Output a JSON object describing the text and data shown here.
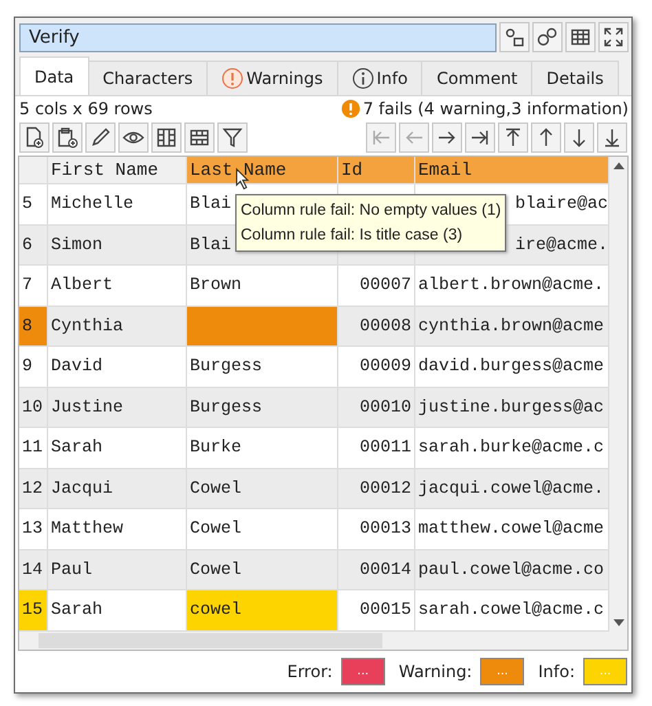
{
  "window": {
    "title": "Verify",
    "title_buttons": [
      {
        "kind": "settings-small"
      },
      {
        "kind": "gears"
      },
      {
        "kind": "table"
      },
      {
        "kind": "expand"
      }
    ]
  },
  "tabs": [
    {
      "label": "Data",
      "selected": true
    },
    {
      "label": "Characters",
      "selected": false
    },
    {
      "label": "Warnings",
      "selected": false,
      "kind": "warning"
    },
    {
      "label": "Info",
      "selected": false,
      "kind": "info"
    },
    {
      "label": "Comment",
      "selected": false
    },
    {
      "label": "Details",
      "selected": false
    }
  ],
  "summary": "5 cols x 69 rows",
  "fails": "7 fails (4 warning,3 information)",
  "toolbar": [
    {
      "kind": "new-file"
    },
    {
      "kind": "paste"
    },
    {
      "kind": "pencil"
    },
    {
      "kind": "eye"
    },
    {
      "kind": "columns"
    },
    {
      "kind": "rows"
    },
    {
      "kind": "filter"
    }
  ],
  "navigation": [
    {
      "kind": "first",
      "disabled": true
    },
    {
      "kind": "left",
      "disabled": true
    },
    {
      "kind": "right",
      "disabled": false
    },
    {
      "kind": "last",
      "disabled": false
    },
    {
      "kind": "top",
      "disabled": false
    },
    {
      "kind": "up",
      "disabled": false
    },
    {
      "kind": "down",
      "disabled": false
    },
    {
      "kind": "bottom",
      "disabled": false
    }
  ],
  "table": {
    "columns": [
      {
        "label": "First Name",
        "highlighted": false
      },
      {
        "label": "Last Name",
        "highlighted": true
      },
      {
        "label": "Id",
        "highlighted": true
      },
      {
        "label": "Email",
        "highlighted": true
      }
    ],
    "rows": [
      {
        "num": "5",
        "first": "Michelle",
        "last": "Blai",
        "email": "blaire@ac",
        "warning": false,
        "info": false,
        "covered": true
      },
      {
        "num": "6",
        "first": "Simon",
        "last": "Blai",
        "email": "ire@acme.",
        "warning": false,
        "info": false,
        "covered": true
      },
      {
        "num": "7",
        "first": "Albert",
        "last": "Brown",
        "id": "00007",
        "email": "albert.brown@acme.",
        "warning": false,
        "info": false,
        "covered": false
      },
      {
        "num": "8",
        "first": "Cynthia",
        "id": "00008",
        "email": "cynthia.brown@acme",
        "warning": true,
        "info": false,
        "covered": false
      },
      {
        "num": "9",
        "first": "David",
        "last": "Burgess",
        "id": "00009",
        "email": "david.burgess@acme",
        "warning": false,
        "info": false,
        "covered": false
      },
      {
        "num": "10",
        "first": "Justine",
        "last": "Burgess",
        "id": "00010",
        "email": "justine.burgess@ac",
        "warning": false,
        "info": false,
        "covered": false
      },
      {
        "num": "11",
        "first": "Sarah",
        "last": "Burke",
        "id": "00011",
        "email": "sarah.burke@acme.c",
        "warning": false,
        "info": false,
        "covered": false
      },
      {
        "num": "12",
        "first": "Jacqui",
        "last": "Cowel",
        "id": "00012",
        "email": "jacqui.cowel@acme.",
        "warning": false,
        "info": false,
        "covered": false
      },
      {
        "num": "13",
        "first": "Matthew",
        "last": "Cowel",
        "id": "00013",
        "email": "matthew.cowel@acme",
        "warning": false,
        "info": false,
        "covered": false
      },
      {
        "num": "14",
        "first": "Paul",
        "last": "Cowel",
        "id": "00014",
        "email": "paul.cowel@acme.co",
        "warning": false,
        "info": false,
        "covered": false
      },
      {
        "num": "15",
        "first": "Sarah",
        "last": "cowel",
        "id": "00015",
        "email": "sarah.cowel@acme.c",
        "warning": false,
        "info": true,
        "covered": false
      }
    ]
  },
  "tooltip": [
    "Column rule fail: No empty values (1)",
    "Column rule fail: Is title case (3)"
  ],
  "legend": [
    {
      "label": "Error:",
      "button": "...",
      "color": "#e8405a"
    },
    {
      "label": "Warning:",
      "button": "...",
      "color": "#ee8a0c"
    },
    {
      "label": "Info:",
      "button": "...",
      "color": "#fdd400"
    }
  ]
}
